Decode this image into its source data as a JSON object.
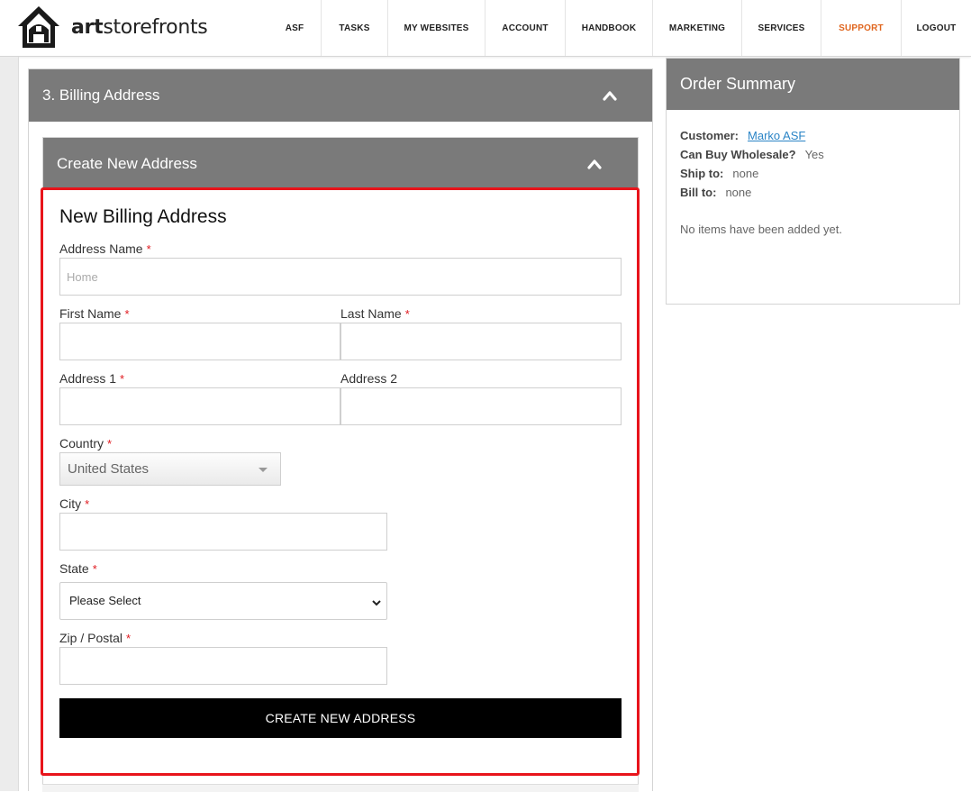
{
  "brand": {
    "name_bold": "art",
    "name_rest": "storefronts"
  },
  "nav": [
    {
      "label": "ASF",
      "id": "asf"
    },
    {
      "label": "TASKS",
      "id": "tasks"
    },
    {
      "label": "MY WEBSITES",
      "id": "my-websites"
    },
    {
      "label": "ACCOUNT",
      "id": "account"
    },
    {
      "label": "HANDBOOK",
      "id": "handbook"
    },
    {
      "label": "MARKETING",
      "id": "marketing"
    },
    {
      "label": "SERVICES",
      "id": "services"
    },
    {
      "label": "SUPPORT",
      "id": "support",
      "active": true
    },
    {
      "label": "LOGOUT",
      "id": "logout"
    }
  ],
  "colors": {
    "accent": "#e0661f",
    "header_bg": "#7a7a7a",
    "highlight": "#e8141b",
    "link": "#2a84c6"
  },
  "billing": {
    "section_title": "3. Billing Address",
    "subsection_title": "Create New Address",
    "form_title": "New Billing Address",
    "required_mark": "*",
    "fields": {
      "address_name": {
        "label": "Address Name",
        "placeholder": "Home",
        "value": ""
      },
      "first_name": {
        "label": "First Name",
        "value": ""
      },
      "last_name": {
        "label": "Last Name",
        "value": ""
      },
      "address1": {
        "label": "Address 1",
        "value": ""
      },
      "address2": {
        "label": "Address 2",
        "value": ""
      },
      "country": {
        "label": "Country",
        "value": "United States"
      },
      "city": {
        "label": "City",
        "value": ""
      },
      "state": {
        "label": "State",
        "value": "Please Select"
      },
      "zip": {
        "label": "Zip / Postal",
        "value": ""
      }
    },
    "submit_label": "CREATE NEW ADDRESS"
  },
  "summary": {
    "title": "Order Summary",
    "customer_label": "Customer:",
    "customer_value": "Marko ASF",
    "wholesale_label": "Can Buy Wholesale?",
    "wholesale_value": "Yes",
    "ship_label": "Ship to:",
    "ship_value": "none",
    "bill_label": "Bill to:",
    "bill_value": "none",
    "empty_text": "No items have been added yet."
  }
}
